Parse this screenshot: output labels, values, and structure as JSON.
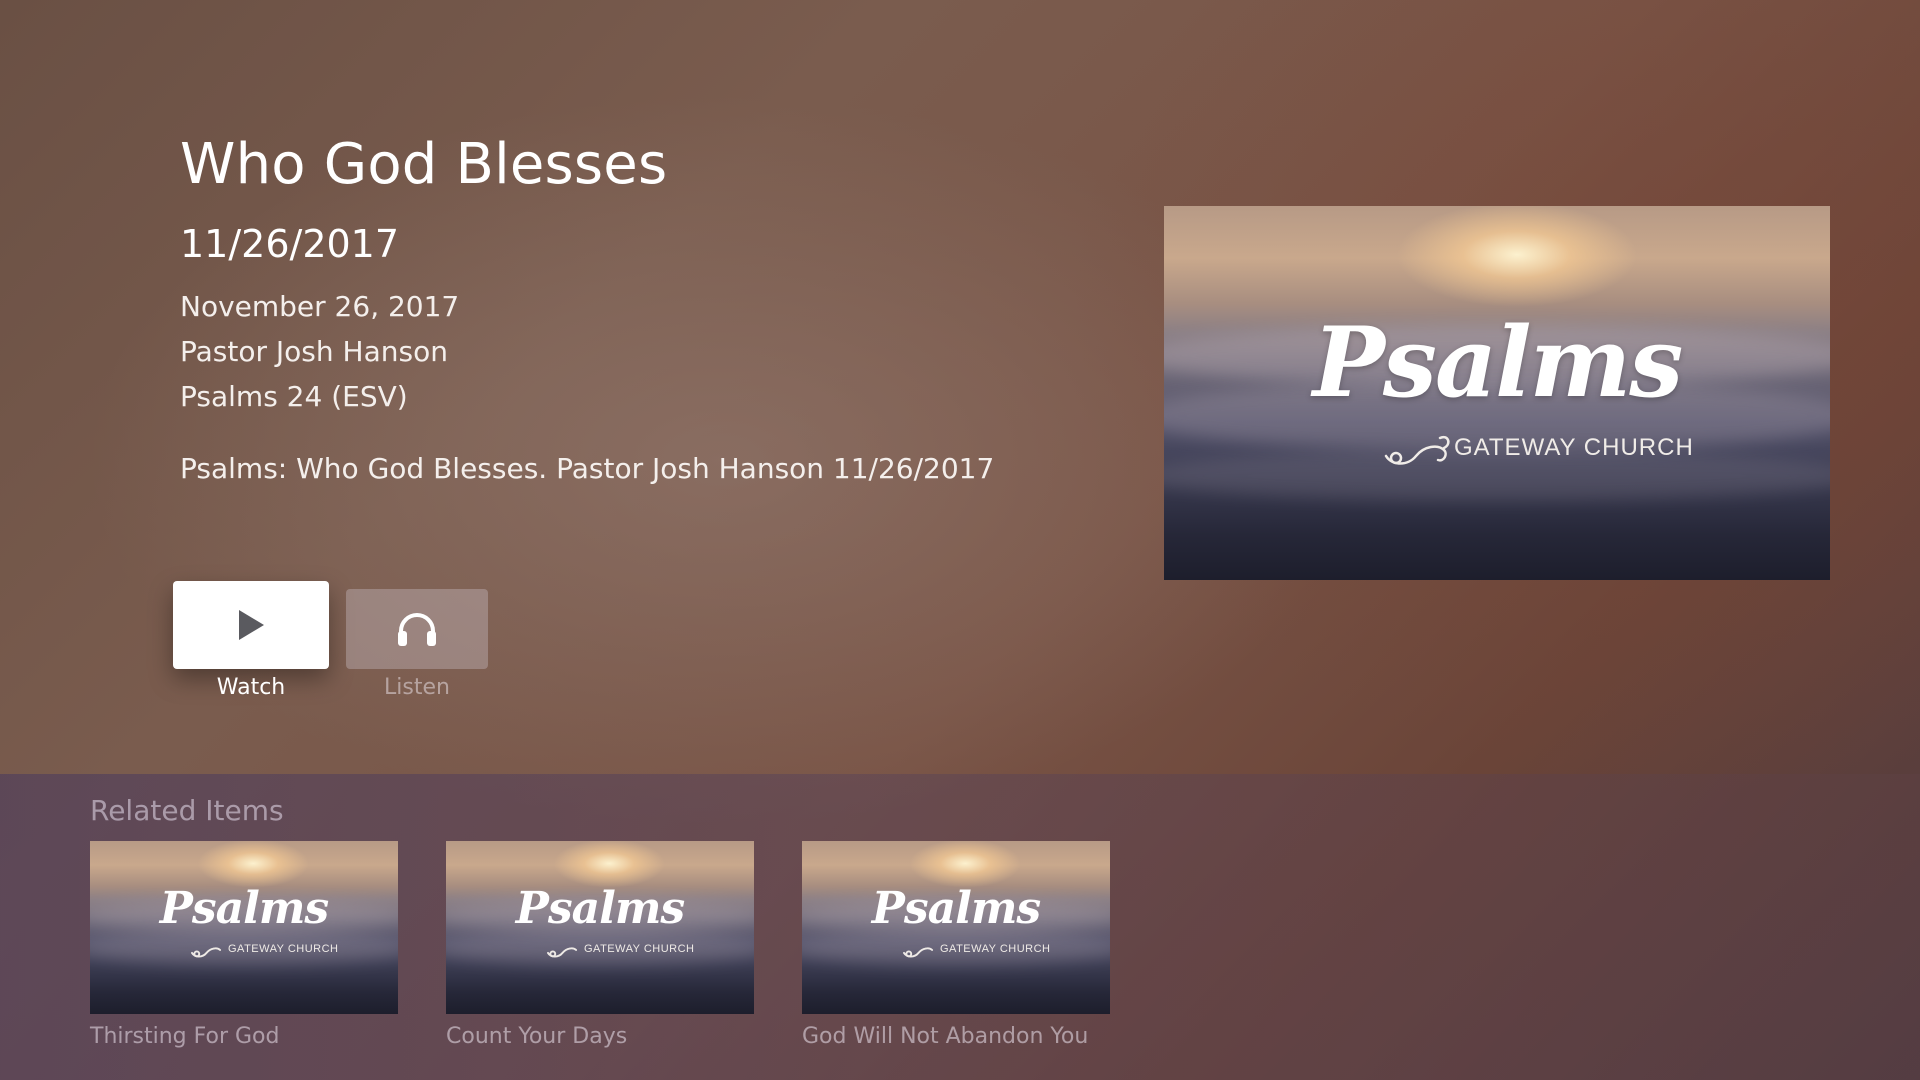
{
  "detail": {
    "title": "Who God Blesses",
    "date_short": "11/26/2017",
    "date_long": "November 26, 2017",
    "speaker": "Pastor Josh Hanson",
    "scripture": "Psalms 24 (ESV)",
    "description": "Psalms: Who God Blesses. Pastor Josh Hanson 11/26/2017"
  },
  "actions": {
    "watch_label": "Watch",
    "watch_icon": "play-icon",
    "listen_label": "Listen",
    "listen_icon": "headphones-icon"
  },
  "artwork": {
    "series_word": "Psalms",
    "church_word": "GATEWAY CHURCH",
    "flourish_glyph": "ꟼ"
  },
  "related": {
    "heading": "Related Items",
    "items": [
      {
        "label": "Thirsting For God",
        "series_word": "Psalms",
        "church_word": "GATEWAY CHURCH"
      },
      {
        "label": "Count Your Days",
        "series_word": "Psalms",
        "church_word": "GATEWAY CHURCH"
      },
      {
        "label": "God Will Not Abandon You",
        "series_word": "Psalms",
        "church_word": "GATEWAY CHURCH"
      }
    ]
  }
}
